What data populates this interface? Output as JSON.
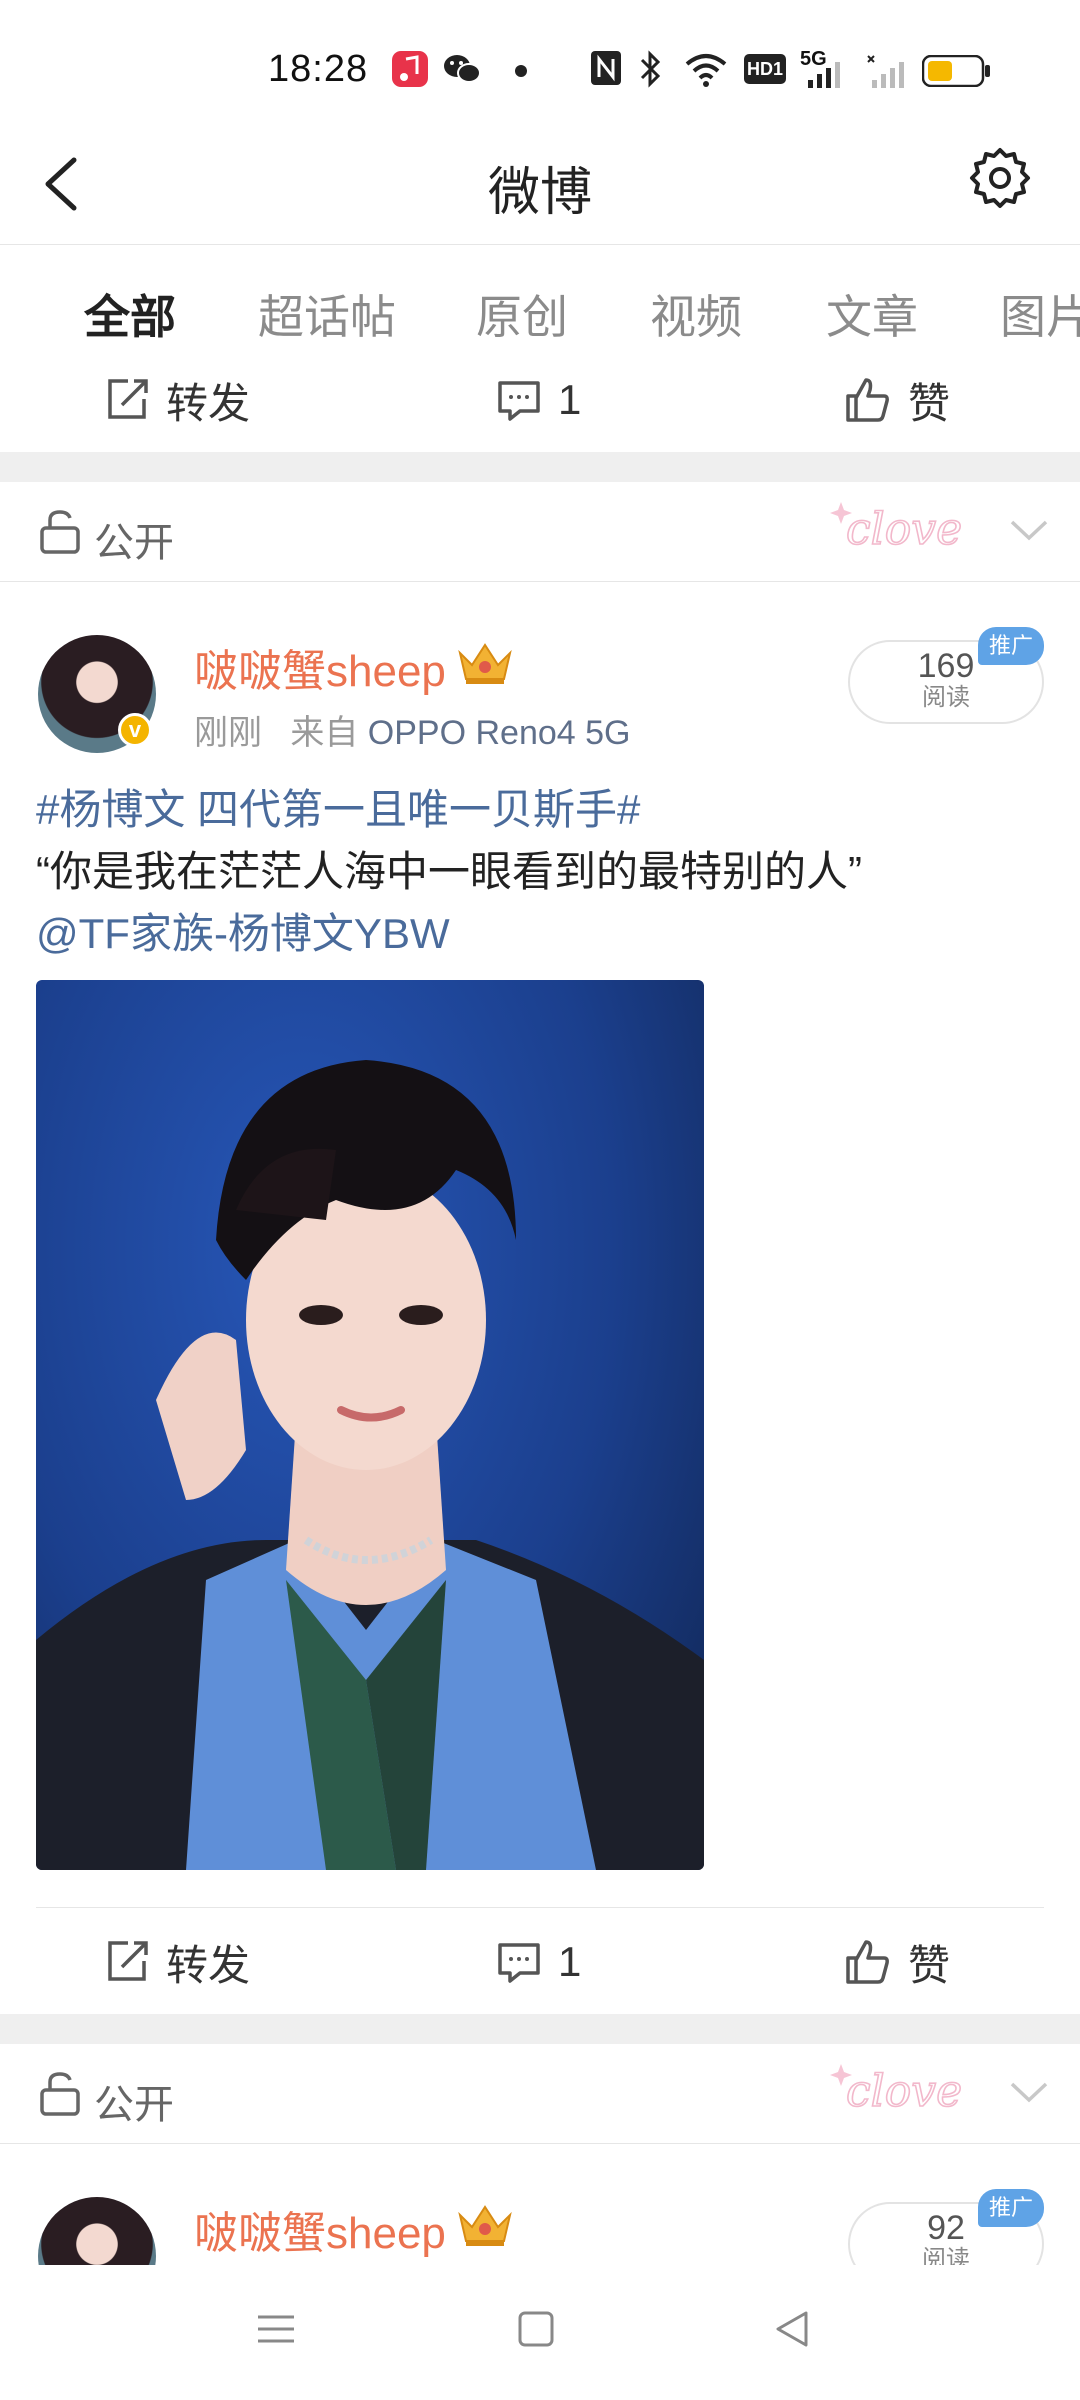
{
  "status_bar": {
    "time": "18:28",
    "network": "5G",
    "hd_badge": "HD1",
    "icons": [
      "music-app-icon",
      "wechat-icon",
      "notification-dot-icon",
      "nfc-icon",
      "bluetooth-icon",
      "wifi-icon",
      "hd-volte-icon",
      "signal-5g-icon",
      "signal-no-service-icon",
      "battery-low-icon"
    ]
  },
  "header": {
    "title": "微博",
    "back_icon": "chevron-left-icon",
    "settings_icon": "gear-icon"
  },
  "tabs": [
    {
      "label": "全部",
      "active": true
    },
    {
      "label": "超话帖",
      "active": false
    },
    {
      "label": "原创",
      "active": false
    },
    {
      "label": "视频",
      "active": false
    },
    {
      "label": "文章",
      "active": false
    },
    {
      "label": "图片",
      "active": false
    }
  ],
  "colors": {
    "accent": "#ff8200",
    "username": "#eb7350",
    "link": "#4a6b9b",
    "promo_badge": "#5fa3e6",
    "divider_gap": "#efefef"
  },
  "top_actions": {
    "repost": "转发",
    "comment_count": "1",
    "like": "赞"
  },
  "feed": [
    {
      "privacy": "公开",
      "username": "啵啵蟹sheep",
      "time": "刚刚",
      "source_prefix": "来自",
      "device": "OPPO Reno4 5G",
      "reads": "169",
      "reads_label": "阅读",
      "promo_badge": "推广",
      "hashtag": "#杨博文 四代第一且唯一贝斯手#",
      "quote": "“你是我在茫茫人海中一眼看到的最特别的人”",
      "mention": "@TF家族-杨博文YBW",
      "actions": {
        "repost": "转发",
        "comment_count": "1",
        "like": "赞"
      }
    },
    {
      "privacy": "公开",
      "username": "啵啵蟹sheep",
      "reads": "92",
      "reads_label": "阅读",
      "promo_badge": "推广"
    }
  ]
}
